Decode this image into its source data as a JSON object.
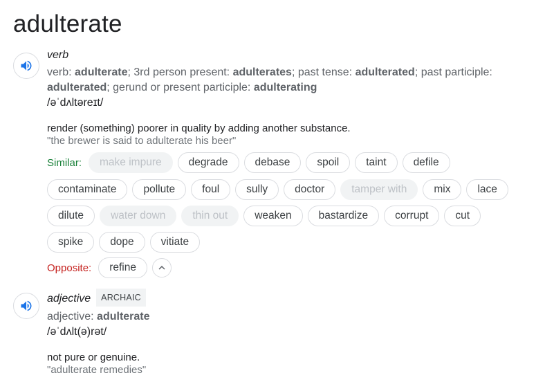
{
  "headword": "adulterate",
  "verb": {
    "pos": "verb",
    "forms": {
      "verb_label": "verb: ",
      "verb": "adulterate",
      "p3_label": "; 3rd person present: ",
      "p3": "adulterates",
      "past_label": "; past tense: ",
      "past": "adulterated",
      "pp_label": "; past participle: ",
      "pp": "adulterated",
      "ger_label": "; gerund or present participle: ",
      "ger": "adulterating"
    },
    "phonetic": "/əˈdʌltəreɪt/",
    "definition": "render (something) poorer in quality by adding another substance.",
    "example": "\"the brewer is said to adulterate his beer\"",
    "similar_label": "Similar:",
    "similar_row1": [
      "make impure",
      "degrade",
      "debase",
      "spoil",
      "taint",
      "defile"
    ],
    "similar_row2": [
      "contaminate",
      "pollute",
      "foul",
      "sully",
      "doctor",
      "tamper with",
      "mix",
      "lace"
    ],
    "similar_row3": [
      "dilute",
      "water down",
      "thin out",
      "weaken",
      "bastardize",
      "corrupt",
      "cut"
    ],
    "similar_row4": [
      "spike",
      "dope",
      "vitiate"
    ],
    "muted": [
      "make impure",
      "tamper with",
      "water down",
      "thin out"
    ],
    "opposite_label": "Opposite:",
    "opposite": [
      "refine"
    ]
  },
  "adjective": {
    "pos": "adjective",
    "badge": "ARCHAIC",
    "forms_label": "adjective: ",
    "forms_value": "adulterate",
    "phonetic": "/əˈdʌlt(ə)rət/",
    "definition": "not pure or genuine.",
    "example": "\"adulterate remedies\""
  },
  "icons": {
    "speaker": "volume-icon",
    "collapse": "chevron-up-icon"
  },
  "colors": {
    "accent": "#1a73e8",
    "similar": "#188038",
    "opposite": "#c5221f"
  }
}
